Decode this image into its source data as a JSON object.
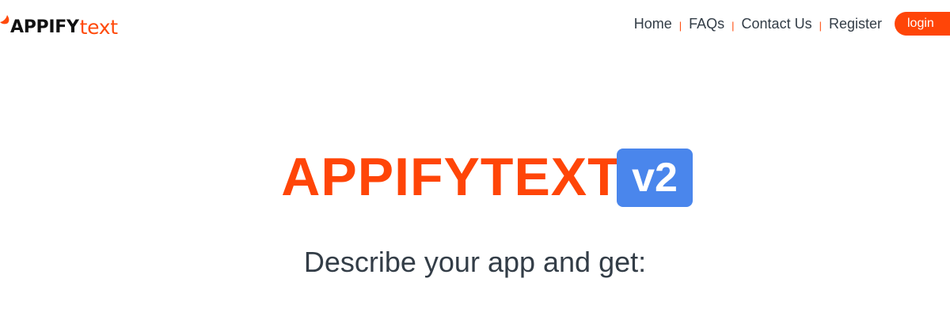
{
  "header": {
    "logo": {
      "brand": "APPIFY",
      "suffix": "text"
    },
    "nav": {
      "items": [
        {
          "label": "Home"
        },
        {
          "label": "FAQs"
        },
        {
          "label": "Contact Us"
        },
        {
          "label": "Register"
        }
      ],
      "separator": "|",
      "login_label": "login"
    }
  },
  "hero": {
    "title": "APPIFYTEXT",
    "version": "v2",
    "subtitle": "Describe your app and get:"
  },
  "colors": {
    "accent": "#ff4508",
    "badge": "#4a86ec",
    "text": "#333d47"
  },
  "icons": {
    "logo_mark": "flame-icon"
  }
}
